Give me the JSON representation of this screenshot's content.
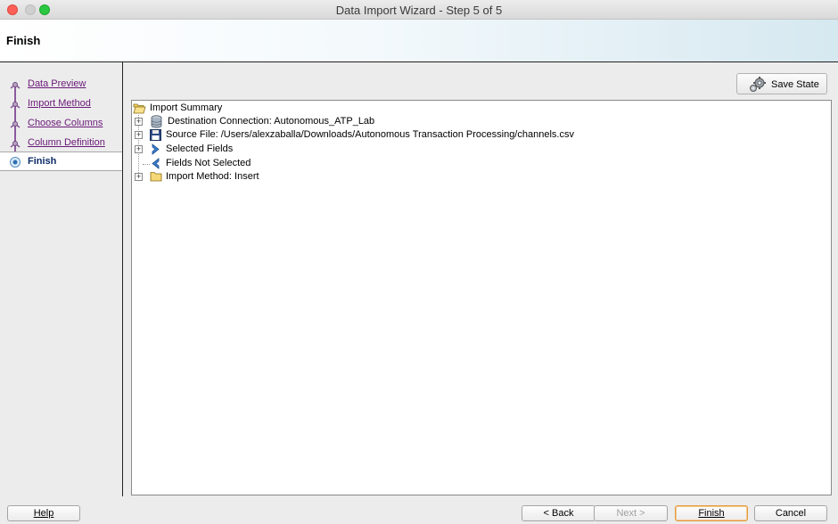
{
  "window": {
    "title": "Data Import Wizard - Step 5 of 5"
  },
  "header": {
    "title": "Finish"
  },
  "steps": [
    {
      "label": "Data Preview",
      "state": "done"
    },
    {
      "label": "Import Method",
      "state": "done"
    },
    {
      "label": "Choose Columns",
      "state": "done"
    },
    {
      "label": "Column Definition",
      "state": "done"
    },
    {
      "label": "Finish",
      "state": "current"
    }
  ],
  "toolbar": {
    "save_state_label": "Save State"
  },
  "tree": {
    "root_label": "Import Summary",
    "items": [
      {
        "label": "Destination Connection: Autonomous_ATP_Lab",
        "icon": "database-icon",
        "expandable": true
      },
      {
        "label": "Source File: /Users/alexzaballa/Downloads/Autonomous Transaction Processing/channels.csv",
        "icon": "floppy-disk-icon",
        "expandable": true
      },
      {
        "label": "Selected Fields",
        "icon": "arrow-right-icon",
        "expandable": true
      },
      {
        "label": "Fields Not Selected",
        "icon": "arrow-left-icon",
        "expandable": false
      },
      {
        "label": "Import Method: Insert",
        "icon": "folder-icon",
        "expandable": true
      }
    ]
  },
  "footer": {
    "help_label": "Help",
    "back_label": "< Back",
    "next_label": "Next >",
    "finish_label": "Finish",
    "cancel_label": "Cancel"
  },
  "colors": {
    "step_link": "#6a1a78",
    "current_step": "#0c2a66",
    "default_button_border": "#e29a3a"
  }
}
